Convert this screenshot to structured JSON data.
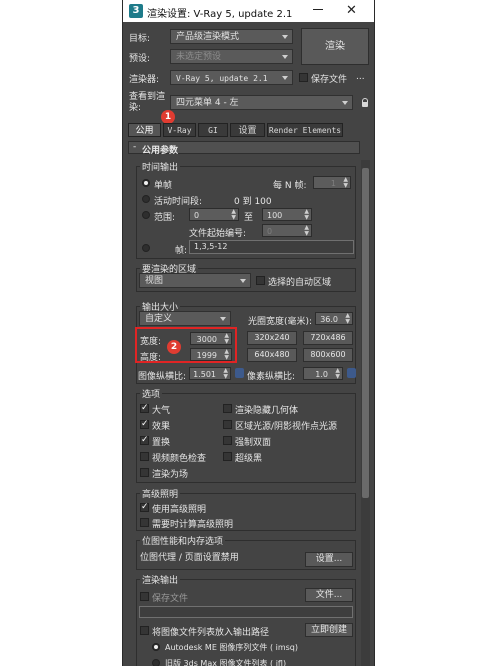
{
  "window": {
    "app_icon": "3",
    "title": "渲染设置: V-Ray 5, update 2.1",
    "close_glyph": "✕"
  },
  "header": {
    "target_label": "目标:",
    "target_value": "产品级渲染模式",
    "preset_label": "预设:",
    "preset_value": "未选定预设",
    "renderer_label": "渲染器:",
    "renderer_value": "V-Ray 5, update 2.1",
    "save_file_label": "保存文件",
    "more_label": "...",
    "view_label": "查看到渲染:",
    "view_value": "四元菜单 4 - 左",
    "render_button": "渲染"
  },
  "tabs": [
    "公用",
    "V-Ray",
    "GI",
    "设置",
    "Render Elements"
  ],
  "badges": {
    "one": "1",
    "two": "2"
  },
  "common": {
    "rollout_title": "公用参数",
    "time_output": {
      "title": "时间输出",
      "single": "单帧",
      "every_n_label": "每 N 帧:",
      "every_n_value": "1",
      "active_segment": "活动时间段:",
      "active_range": "0 到 100",
      "range_label": "范围:",
      "range_from": "0",
      "range_to_label": "至",
      "range_to": "100",
      "file_start_label": "文件起始编号:",
      "file_start_value": "0",
      "frames_label": "帧:",
      "frames_value": "1,3,5-12"
    },
    "area": {
      "title": "要渲染的区域",
      "value": "视图",
      "auto_region": "选择的自动区域"
    },
    "output_size": {
      "title": "输出大小",
      "preset": "自定义",
      "aperture_label": "光圈宽度(毫米):",
      "aperture_value": "36.0",
      "width_label": "宽度:",
      "width_value": "3000",
      "height_label": "高度:",
      "height_value": "1999",
      "presets": [
        "320x240",
        "720x486",
        "640x480",
        "800x600"
      ],
      "image_aspect_label": "图像纵横比:",
      "image_aspect_value": "1.501",
      "pixel_aspect_label": "像素纵横比:",
      "pixel_aspect_value": "1.0"
    },
    "options": {
      "title": "选项",
      "atmosphere": "大气",
      "effects": "效果",
      "displacement": "置换",
      "video_color": "视频颜色检查",
      "render_to_fields": "渲染为场",
      "hidden_geom": "渲染隐藏几何体",
      "area_lights": "区域光源/阴影视作点光源",
      "force_2side": "强制双面",
      "super_black": "超级黑"
    },
    "adv_lighting": {
      "title": "高级照明",
      "use": "使用高级照明",
      "compute": "需要时计算高级照明"
    },
    "bitmap": {
      "title": "位图性能和内存选项",
      "value": "位图代理 / 页面设置禁用",
      "setup_button": "设置..."
    },
    "render_output": {
      "title": "渲染输出",
      "save_file": "保存文件",
      "files_button": "文件...",
      "put_image_list": "将图像文件列表放入输出路径",
      "create_now": "立即创建",
      "autodesk_seq": "Autodesk ME 图像序列文件 ( imsq)",
      "legacy_list": "旧版 3ds Max 图像文件列表 ( ifl)"
    }
  }
}
